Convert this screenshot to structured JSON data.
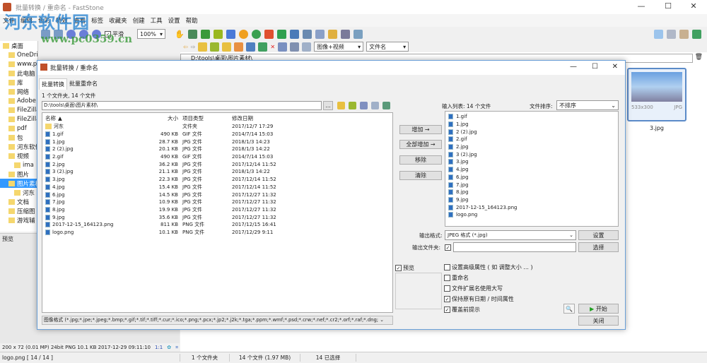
{
  "window": {
    "title": "批量转换 / 重命名 - FastStone",
    "min": "—",
    "max": "☐",
    "close": "✕"
  },
  "menu": [
    "文件",
    "编辑",
    "色彩",
    "特效",
    "查看",
    "标签",
    "收藏夹",
    "创建",
    "工具",
    "设置",
    "帮助"
  ],
  "toolbar": {
    "smooth_label": "平滑",
    "zoom": "100%",
    "filter": "图像+视频",
    "sort": "文件名"
  },
  "watermark": {
    "name": "河东软件园",
    "url": "www.pc0359.cn"
  },
  "tree": {
    "items": [
      "桌面",
      "OneDrive",
      "www.p",
      "此电脑",
      "库",
      "网络",
      "Adobe",
      "FileZilla",
      "FileZilla",
      "pdf",
      "包",
      "河东软件",
      "视频",
      "ima",
      "图片",
      "图片素材",
      "河东",
      "文档",
      "压缩图",
      "游戏辅"
    ],
    "selected": "图片素材",
    "preview_label": "预览"
  },
  "address": "D:\\tools\\桌面\\图片素材\\",
  "thumbnail": {
    "dims": "533x300",
    "type": "JPG",
    "name": "3.jpg"
  },
  "dialog": {
    "title": "批量转换 / 重命名",
    "close": "✕",
    "max": "☐",
    "min": "—",
    "tabs": [
      "批量转换",
      "批量重命名"
    ],
    "summary": "1 个文件夹, 14 个文件",
    "path": "D:\\tools\\桌面\\图片素材\\",
    "browse": "...",
    "columns": [
      "名称",
      "大小",
      "项目类型",
      "修改日期"
    ],
    "files": [
      {
        "name": "河东",
        "size": "",
        "type": "文件夹",
        "date": "2017/12/7 17:29",
        "folder": true
      },
      {
        "name": "1.gif",
        "size": "490 KB",
        "type": "GIF 文件",
        "date": "2014/7/14 15:03"
      },
      {
        "name": "1.jpg",
        "size": "28.7 KB",
        "type": "JPG 文件",
        "date": "2018/1/3 14:23"
      },
      {
        "name": "2 (2).jpg",
        "size": "20.1 KB",
        "type": "JPG 文件",
        "date": "2018/1/3 14:22"
      },
      {
        "name": "2.gif",
        "size": "490 KB",
        "type": "GIF 文件",
        "date": "2014/7/14 15:03"
      },
      {
        "name": "2.jpg",
        "size": "36.2 KB",
        "type": "JPG 文件",
        "date": "2017/12/14 11:52"
      },
      {
        "name": "3 (2).jpg",
        "size": "21.1 KB",
        "type": "JPG 文件",
        "date": "2018/1/3 14:22"
      },
      {
        "name": "3.jpg",
        "size": "22.3 KB",
        "type": "JPG 文件",
        "date": "2017/12/14 11:52"
      },
      {
        "name": "4.jpg",
        "size": "15.4 KB",
        "type": "JPG 文件",
        "date": "2017/12/14 11:52"
      },
      {
        "name": "6.jpg",
        "size": "14.5 KB",
        "type": "JPG 文件",
        "date": "2017/12/27 11:32"
      },
      {
        "name": "7.jpg",
        "size": "10.9 KB",
        "type": "JPG 文件",
        "date": "2017/12/27 11:32"
      },
      {
        "name": "8.jpg",
        "size": "19.9 KB",
        "type": "JPG 文件",
        "date": "2017/12/27 11:32"
      },
      {
        "name": "9.jpg",
        "size": "35.6 KB",
        "type": "JPG 文件",
        "date": "2017/12/27 11:32"
      },
      {
        "name": "2017-12-15_164123.png",
        "size": "811 KB",
        "type": "PNG 文件",
        "date": "2017/12/15 16:41"
      },
      {
        "name": "logo.png",
        "size": "10.1 KB",
        "type": "PNG 文件",
        "date": "2017/12/29 9:11"
      }
    ],
    "filter": "图像格式 (*.jpg;*.jpe;*.jpeg;*.bmp;*.gif;*.tif;*.tiff;*.cur;*.ico;*.png;*.pcx;*.jp2;*.j2k;*.tga;*.ppm;*.wmf;*.psd;*.crw;*.nef;*.cr2;*.orf;*.raf;*.dng;",
    "buttons": {
      "add": "增加 →",
      "add_all": "全部增加 →",
      "remove": "移除",
      "clear": "清除",
      "settings": "设置",
      "choose": "选择",
      "start": "开始",
      "close": "关闭"
    },
    "input_list_label": "输入列表: 14 个文件",
    "sort_label": "文件排序:",
    "sort_value": "不排序",
    "input_list": [
      "1.gif",
      "1.jpg",
      "2 (2).jpg",
      "2.gif",
      "2.jpg",
      "3 (2).jpg",
      "3.jpg",
      "4.jpg",
      "6.jpg",
      "7.jpg",
      "8.jpg",
      "9.jpg",
      "2017-12-15_164123.png",
      "logo.png"
    ],
    "output_format_label": "输出格式:",
    "output_format": "JPEG 格式 (*.jpg)",
    "output_folder_label": "输出文件夹:",
    "output_folder": "",
    "preview_label": "预览",
    "options": [
      {
        "label": "设置高级属性 ( 如 调整大小 ... )",
        "checked": false
      },
      {
        "label": "重命名",
        "checked": false
      },
      {
        "label": "文件扩展名使用大写",
        "checked": false
      },
      {
        "label": "保持原有日期 / 时间属性",
        "checked": true
      },
      {
        "label": "覆盖前提示",
        "checked": true
      }
    ]
  },
  "info_bar": {
    "text": "200 x 72 (0.01 MP)  24bit  PNG   10.1 KB   2017-12-29 09:11:10",
    "ratio": "1:1"
  },
  "status": {
    "file": "logo.png [ 14 / 14 ]",
    "folders": "1 个文件夹",
    "files": "14 个文件 (1.97 MB)",
    "selected": "14 已选择"
  }
}
